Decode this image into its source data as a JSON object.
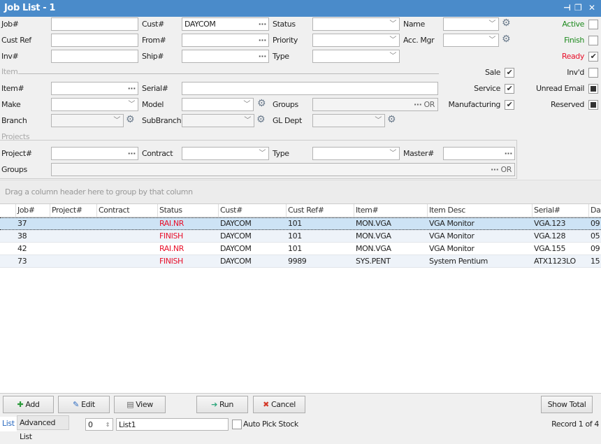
{
  "window": {
    "title": "Job List - 1",
    "pin_icon": "pin-icon",
    "restore_icon": "restore-icon",
    "close_icon": "close-icon"
  },
  "filters": {
    "job": {
      "label": "Job#",
      "value": ""
    },
    "cust": {
      "label": "Cust#",
      "value": "DAYCOM"
    },
    "status": {
      "label": "Status",
      "value": ""
    },
    "name": {
      "label": "Name",
      "value": ""
    },
    "cust_ref": {
      "label": "Cust Ref",
      "value": ""
    },
    "from": {
      "label": "From#",
      "value": ""
    },
    "priority": {
      "label": "Priority",
      "value": ""
    },
    "acc_mgr": {
      "label": "Acc. Mgr",
      "value": ""
    },
    "inv": {
      "label": "Inv#",
      "value": ""
    },
    "ship": {
      "label": "Ship#",
      "value": ""
    },
    "type": {
      "label": "Type",
      "value": ""
    },
    "item_section": "Item",
    "item": {
      "label": "Item#",
      "value": ""
    },
    "serial": {
      "label": "Serial#",
      "value": ""
    },
    "make": {
      "label": "Make",
      "value": ""
    },
    "model": {
      "label": "Model",
      "value": ""
    },
    "groups": {
      "label": "Groups",
      "value": "",
      "or": "OR"
    },
    "branch": {
      "label": "Branch",
      "value": ""
    },
    "subbranch": {
      "label": "SubBranch",
      "value": ""
    },
    "gl_dept": {
      "label": "GL Dept",
      "value": ""
    },
    "projects_section": "Projects",
    "project": {
      "label": "Project#",
      "value": ""
    },
    "contract": {
      "label": "Contract",
      "value": ""
    },
    "ptype": {
      "label": "Type",
      "value": ""
    },
    "master": {
      "label": "Master#",
      "value": ""
    },
    "pgroups": {
      "label": "Groups",
      "value": "",
      "or": "OR"
    }
  },
  "checks": {
    "active": {
      "label": "Active",
      "checked": false,
      "color": "#1e8a1e"
    },
    "finish": {
      "label": "Finish",
      "checked": false,
      "color": "#1e8a1e"
    },
    "ready": {
      "label": "Ready",
      "checked": true,
      "color": "#e8102a"
    },
    "sale": {
      "label": "Sale",
      "checked": true
    },
    "invd": {
      "label": "Inv'd",
      "checked": false
    },
    "service": {
      "label": "Service",
      "checked": true
    },
    "unread_email": {
      "label": "Unread Email",
      "state": "indeterminate"
    },
    "manufacturing": {
      "label": "Manufacturing",
      "checked": true
    },
    "reserved": {
      "label": "Reserved",
      "state": "indeterminate"
    }
  },
  "group_panel": "Drag a column header here to group by that column",
  "grid": {
    "columns": [
      "Job#",
      "Project#",
      "Contract",
      "Status",
      "Cust#",
      "Cust Ref#",
      "Item#",
      "Item Desc",
      "Serial#",
      "Da"
    ],
    "rows": [
      [
        "37",
        "",
        "",
        "RAI.NR",
        "DAYCOM",
        "101",
        "MON.VGA",
        "VGA Monitor",
        "VGA.123",
        "09"
      ],
      [
        "38",
        "",
        "",
        "FINISH",
        "DAYCOM",
        "101",
        "MON.VGA",
        "VGA Monitor",
        "VGA.128",
        "05"
      ],
      [
        "42",
        "",
        "",
        "RAI.NR",
        "DAYCOM",
        "101",
        "MON.VGA",
        "VGA Monitor",
        "VGA.155",
        "09"
      ],
      [
        "73",
        "",
        "",
        "FINISH",
        "DAYCOM",
        "9989",
        "SYS.PENT",
        "System Pentium",
        "ATX1123LO",
        "15"
      ]
    ]
  },
  "buttons": {
    "add": "Add",
    "edit": "Edit",
    "view": "View",
    "run": "Run",
    "cancel": "Cancel",
    "show_total": "Show Total"
  },
  "footer": {
    "tab_list": "List",
    "tab_advanced": "Advanced List",
    "spinner": "0",
    "list_name": "List1",
    "auto_pick": "Auto Pick Stock",
    "record": "Record 1 of 4"
  }
}
